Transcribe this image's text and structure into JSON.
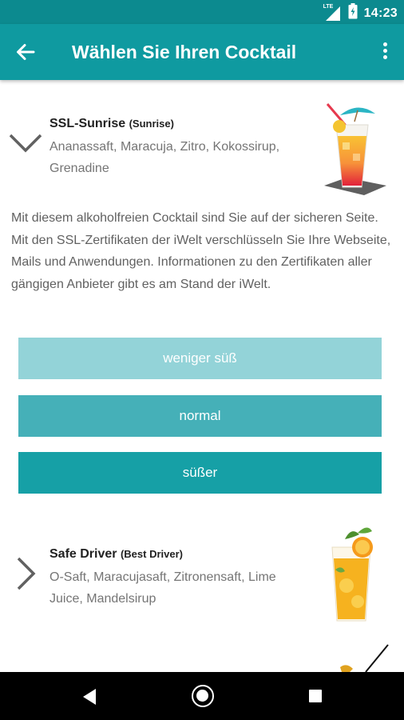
{
  "status_bar": {
    "time": "14:23",
    "network": "LTE",
    "icons": [
      "signal-icon",
      "battery-icon"
    ]
  },
  "app_bar": {
    "title": "Wählen Sie Ihren Cocktail",
    "back_icon": "arrow-back-icon",
    "menu_icon": "more-vertical-icon"
  },
  "cocktails": [
    {
      "name": "SSL-Sunrise",
      "alt_name": "(Sunrise)",
      "ingredients": "Ananassaft, Maracuja, Zitro, Kokossirup, Grenadine",
      "expanded": true,
      "chevron_icon": "chevron-down-icon",
      "image_icon": "sunrise-cocktail-glass-icon",
      "description": "Mit diesem alkoholfreien Cocktail sind Sie auf der sicheren Seite. Mit den SSL-Zertifikaten der iWelt verschlüsseln Sie Ihre Webseite, Mails und Anwendungen. Informationen zu den Zertifikaten aller gängigen Anbieter gibt es am Stand der iWelt.",
      "options": [
        "weniger süß",
        "normal",
        "süßer"
      ]
    },
    {
      "name": "Safe Driver",
      "alt_name": "(Best Driver)",
      "ingredients": "O-Saft, Maracujasaft, Zitronensaft, Lime Juice, Mandelsirup",
      "expanded": false,
      "chevron_icon": "chevron-right-icon",
      "image_icon": "orange-cocktail-glass-icon"
    }
  ],
  "colors": {
    "status_bar": "#0c8a8f",
    "app_bar": "#0f9aa0",
    "option_less": "#93d3d8",
    "option_normal": "#45b0b8",
    "option_more": "#16a0a6"
  },
  "nav_bar": {
    "icons": [
      "nav-back-icon",
      "nav-home-icon",
      "nav-recents-icon"
    ]
  }
}
